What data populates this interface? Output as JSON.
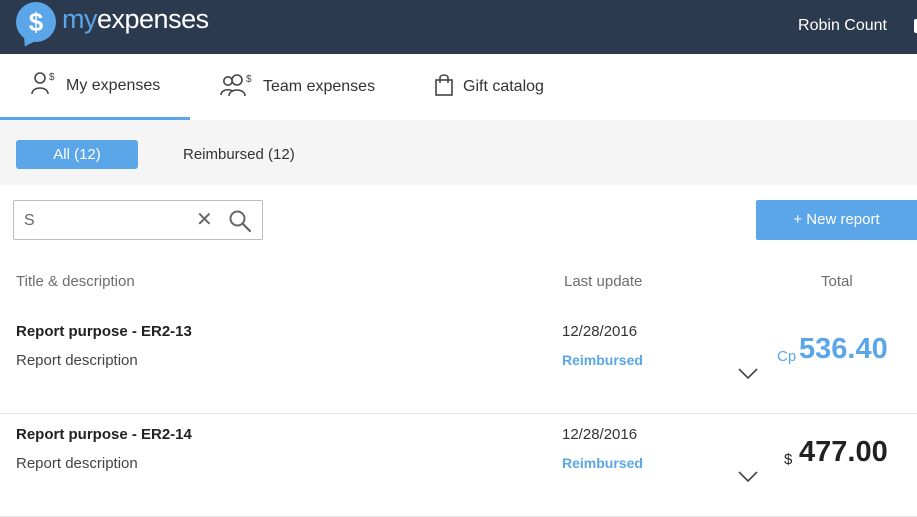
{
  "header": {
    "logo_my": "my",
    "logo_expenses": "expenses",
    "logo_symbol": "$",
    "user_name": "Robin Count"
  },
  "tabs": [
    {
      "label": "My expenses",
      "icon": "user-dollar-icon",
      "active": true
    },
    {
      "label": "Team expenses",
      "icon": "team-dollar-icon",
      "active": false
    },
    {
      "label": "Gift catalog",
      "icon": "shopping-bag-icon",
      "active": false
    }
  ],
  "filters": {
    "all_label": "All (12)",
    "reimbursed_label": "Reimbursed (12)",
    "active": "all"
  },
  "search": {
    "value": "S",
    "placeholder": ""
  },
  "actions": {
    "new_report_label": "+ New report"
  },
  "columns": {
    "title": "Title & description",
    "last_update": "Last update",
    "total": "Total"
  },
  "reports": [
    {
      "title": "Report purpose - ER2-13",
      "description": "Report description",
      "date": "12/28/2016",
      "status": "Reimbursed",
      "currency": "Cp",
      "amount": "536.40"
    },
    {
      "title": "Report purpose - ER2-14",
      "description": "Report description",
      "date": "12/28/2016",
      "status": "Reimbursed",
      "currency": "$",
      "amount": "477.00"
    }
  ],
  "colors": {
    "header_bg": "#2b3a4e",
    "accent": "#5aa6e8",
    "filter_bg": "#f5f5f5"
  }
}
